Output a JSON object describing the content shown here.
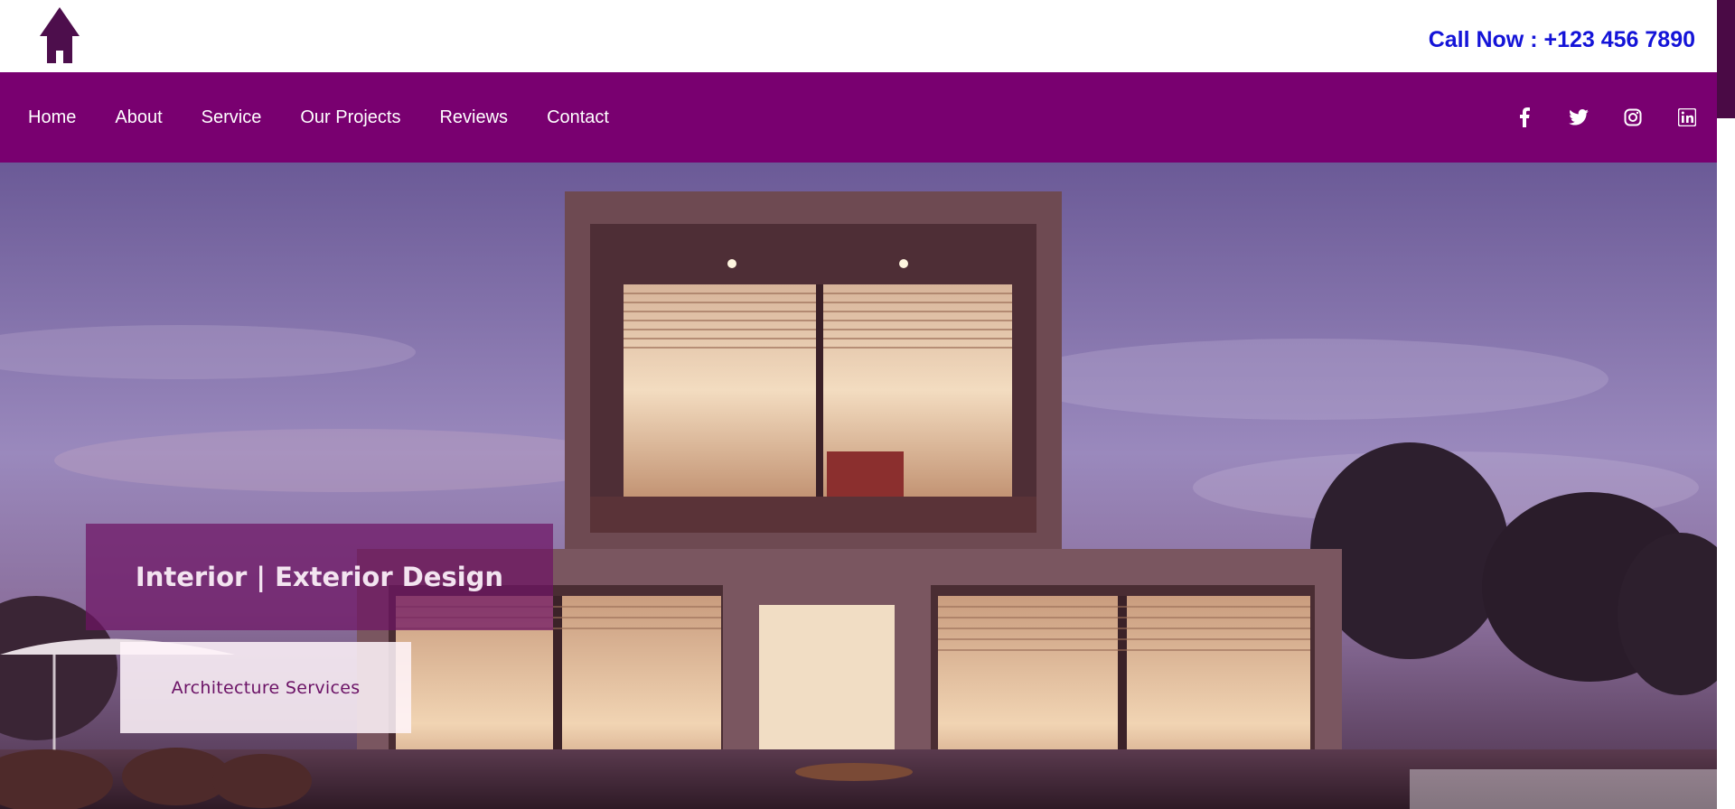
{
  "header": {
    "logo_icon": "house-icon",
    "call_text": "Call Now : +123 456 7890",
    "call_color": "#1414d8"
  },
  "nav": {
    "background": "#790070",
    "items": [
      {
        "label": "Home"
      },
      {
        "label": "About"
      },
      {
        "label": "Service"
      },
      {
        "label": "Our Projects"
      },
      {
        "label": "Reviews"
      },
      {
        "label": "Contact"
      }
    ],
    "social": [
      {
        "icon": "facebook-icon"
      },
      {
        "icon": "twitter-icon"
      },
      {
        "icon": "instagram-icon"
      },
      {
        "icon": "linkedin-icon"
      }
    ]
  },
  "hero": {
    "image": "modern-house-at-dusk",
    "title": "Interior | Exterior Design",
    "subtitle": "Architecture Services"
  }
}
